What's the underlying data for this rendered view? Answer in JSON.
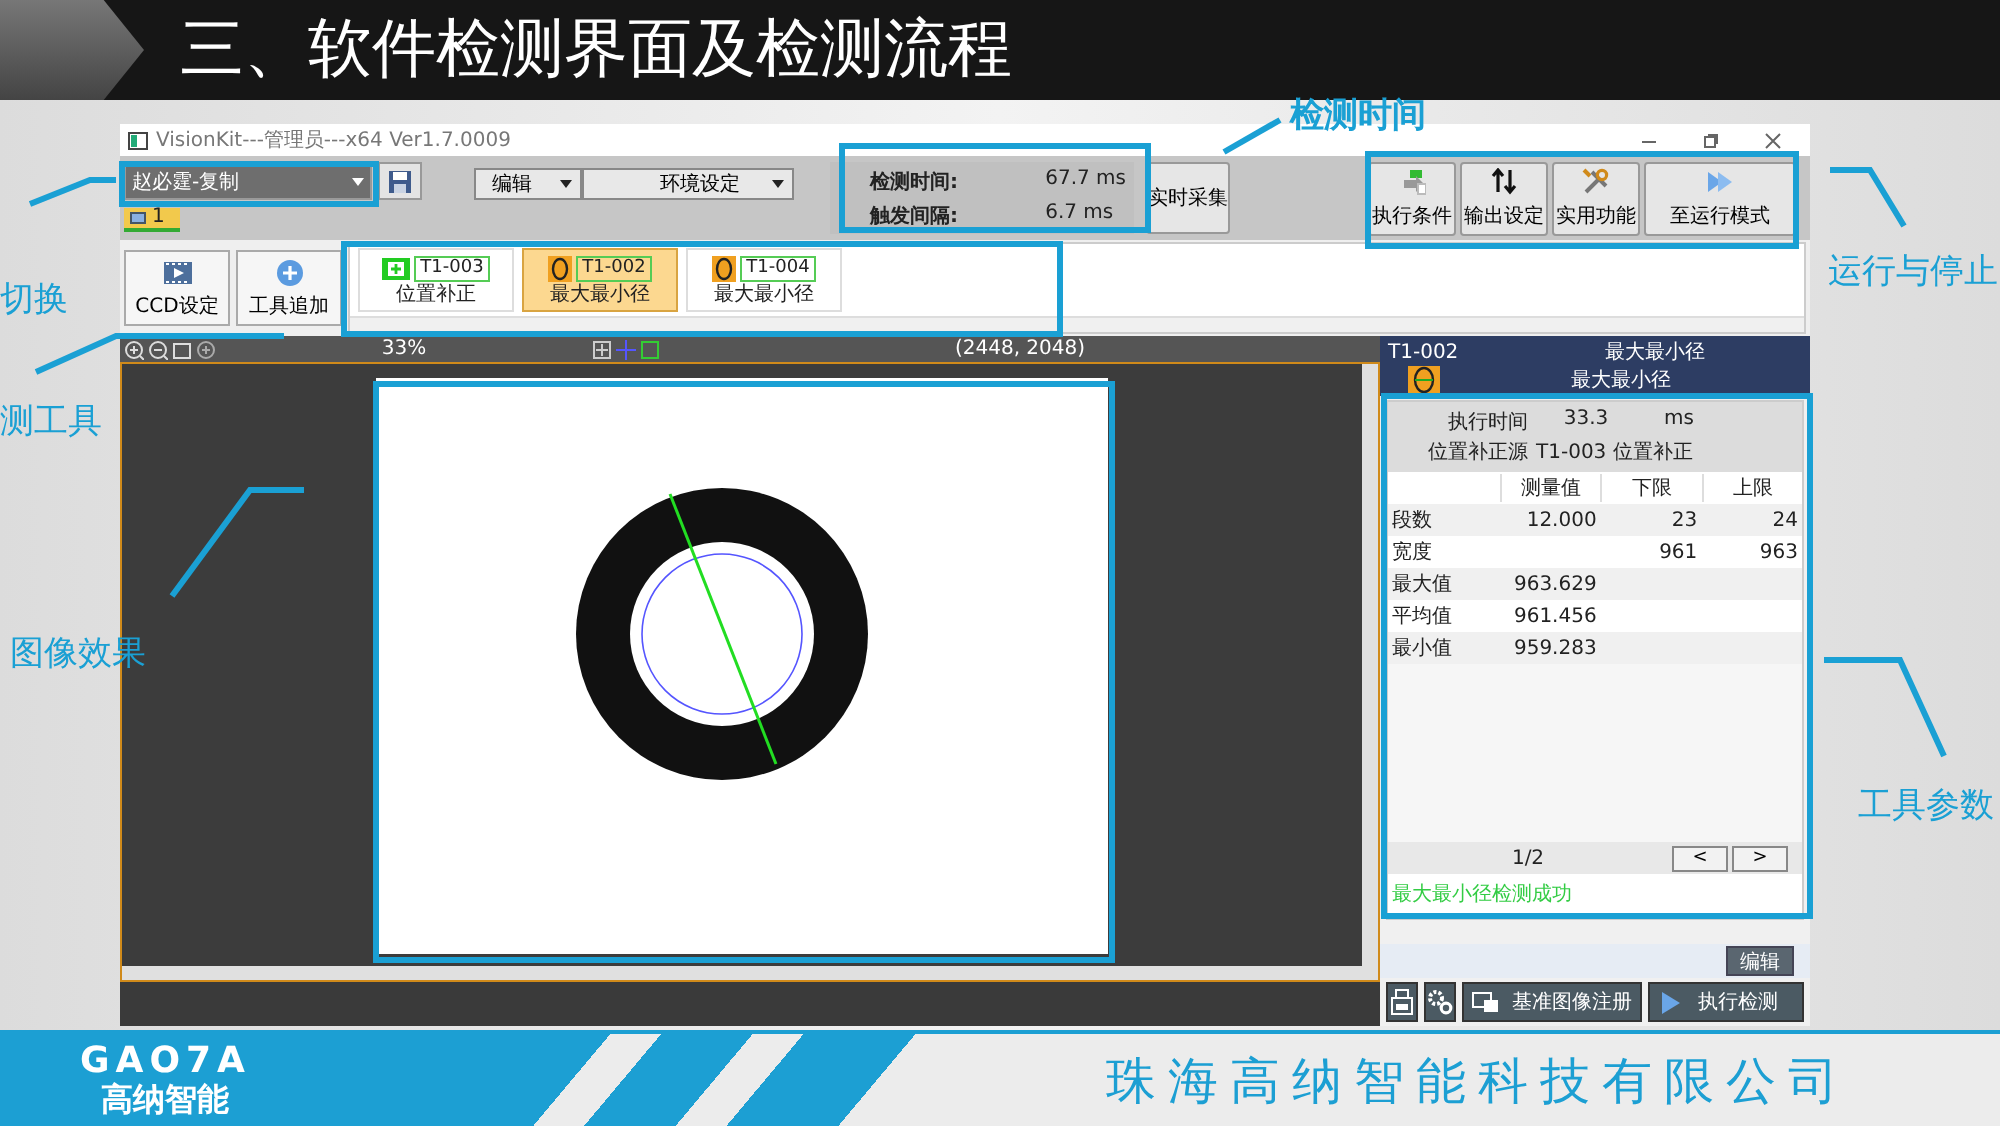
{
  "slide": {
    "title": "三、软件检测界面及检测流程",
    "logo_text": "GAO7A",
    "logo_name": "高纳智能",
    "company": "珠海高纳智能科技有限公司"
  },
  "callouts": [
    {
      "label": "切换"
    },
    {
      "label": "测工具"
    },
    {
      "label": "图像效果"
    },
    {
      "label": "检测时间"
    },
    {
      "label": "运行与停止"
    },
    {
      "label": "工具参数"
    }
  ],
  "window": {
    "title": "VisionKit---管理员---x64 Ver1.7.0009"
  },
  "toolbar": {
    "program": "赵必霆-复制",
    "page_tab": "1",
    "menus": [
      "编辑",
      "环境设定"
    ],
    "timing": [
      {
        "label": "检测时间:",
        "value": "67.7 ms"
      },
      {
        "label": "触发间隔:",
        "value": "6.7 ms"
      }
    ],
    "capture_button": "实时采集",
    "actions": [
      "执行条件",
      "输出设定",
      "实用功能",
      "至运行模式"
    ]
  },
  "side_buttons": [
    "CCD设定",
    "工具追加"
  ],
  "tools": [
    {
      "id": "T1-003",
      "name": "位置补正",
      "kind": "position",
      "selected": false
    },
    {
      "id": "T1-002",
      "name": "最大最小径",
      "kind": "minmax",
      "selected": true
    },
    {
      "id": "T1-004",
      "name": "最大最小径",
      "kind": "minmax",
      "selected": false
    }
  ],
  "viewer": {
    "zoom": "33%",
    "size": "(2448, 2048)"
  },
  "tool_panel": {
    "id": "T1-002",
    "title": "最大最小径",
    "subtitle": "最大最小径",
    "exec_label": "执行时间",
    "exec_value": "33.3",
    "exec_unit": "ms",
    "source_label": "位置补正源",
    "source_value": "T1-003 位置补正",
    "columns": [
      "测量值",
      "下限",
      "上限"
    ],
    "rows": [
      {
        "name": "段数",
        "measured": "12.000",
        "lower": "23",
        "upper": "24"
      },
      {
        "name": "宽度",
        "lower": "961",
        "upper": "963"
      },
      {
        "name": "最大值",
        "measured": "963.629"
      },
      {
        "name": "平均值",
        "measured": "961.456"
      },
      {
        "name": "最小值",
        "measured": "959.283"
      }
    ],
    "page": "1/2",
    "prev": "<",
    "next": ">",
    "message": "最大最小径检测成功"
  },
  "edit_button": "编辑",
  "bottom_buttons": [
    "基准图像注册",
    "执行检测"
  ]
}
